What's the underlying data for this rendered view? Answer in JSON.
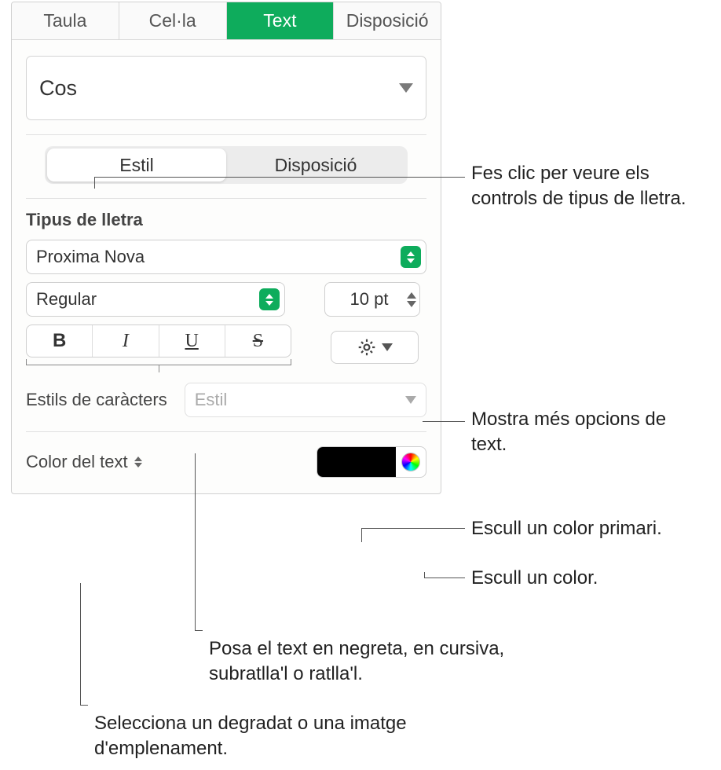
{
  "topTabs": {
    "taula": "Taula",
    "cella": "Cel·la",
    "text": "Text",
    "disposicio": "Disposició"
  },
  "paragraphStyle": "Cos",
  "subTabs": {
    "estil": "Estil",
    "disposicio": "Disposició"
  },
  "fontSection": {
    "label": "Tipus de lletra",
    "family": "Proxima Nova",
    "weight": "Regular",
    "size": "10 pt"
  },
  "charStyles": {
    "label": "Estils de caràcters",
    "placeholder": "Estil"
  },
  "textColor": {
    "label": "Color del text",
    "value": "#000000"
  },
  "callouts": {
    "fontControls": "Fes clic per veure els controls de tipus de lletra.",
    "moreOptions": "Mostra més opcions de text.",
    "primaryColor": "Escull un color primari.",
    "pickColor": "Escull un color.",
    "biug": "Posa el text en negreta, en cursiva, subratlla'l o ratlla'l.",
    "gradient": "Selecciona un degradat o una imatge d'emplenament."
  }
}
